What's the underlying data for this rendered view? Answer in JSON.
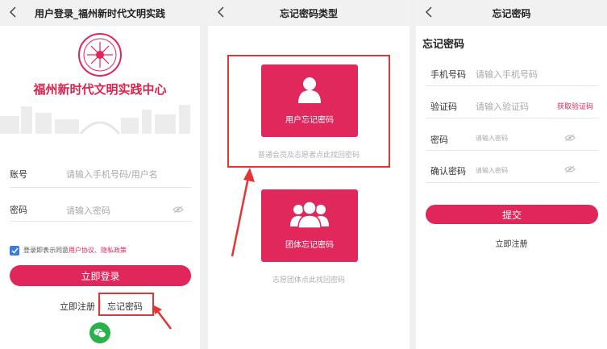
{
  "login": {
    "title": "用户登录_福州新时代文明实践",
    "brand_name": "福州新时代文明实践中心",
    "account_label": "账号",
    "account_placeholder": "请输入手机号码/用户名",
    "password_label": "密码",
    "password_placeholder": "请输入密码",
    "agree_prefix": "登录即表示同意",
    "agree_links": "用户协议、隐私政策",
    "login_button": "立即登录",
    "register_link": "立即注册",
    "forgot_link": "忘记密码"
  },
  "forgot_type": {
    "title": "忘记密码类型",
    "user_card_label": "用户忘记密码",
    "user_card_hint": "普通会员及志愿者点此找回密码",
    "group_card_label": "团体忘记密码",
    "group_card_hint": "志愿团体点此找回密码"
  },
  "forgot": {
    "title": "忘记密码",
    "section_title": "忘记密码",
    "phone_label": "手机号码",
    "phone_placeholder": "请输入手机号码",
    "code_label": "验证码",
    "code_placeholder": "请输入验证码",
    "get_code": "获取验证码",
    "password_label": "密码",
    "password_placeholder": "请输入密码",
    "confirm_label": "确认密码",
    "confirm_placeholder": "请输入密码",
    "submit_button": "提交",
    "register_link": "立即注册"
  },
  "colors": {
    "accent": "#e0265a",
    "annotation": "#e63333"
  }
}
